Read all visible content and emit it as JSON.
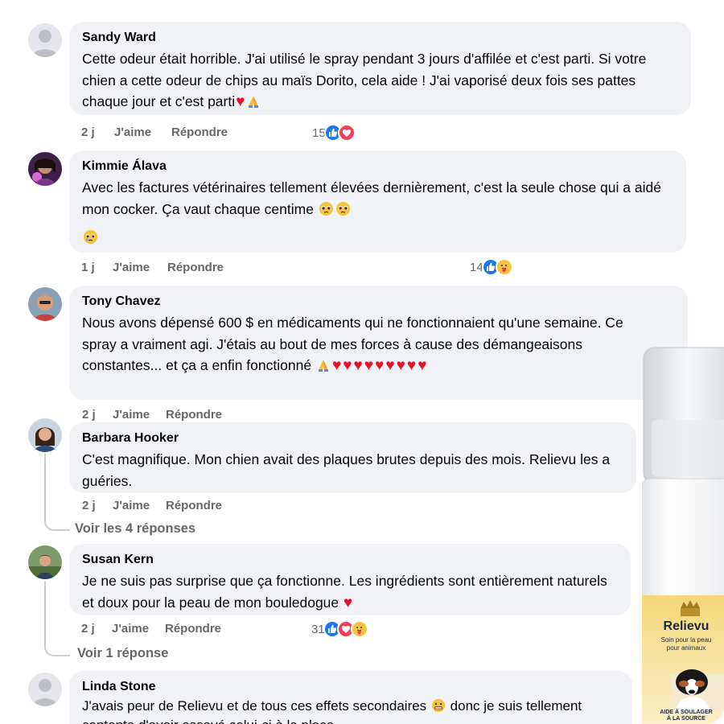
{
  "comments": [
    {
      "author": "Sandy Ward",
      "text": "Cette odeur était horrible. J'ai utilisé le spray pendant 3 jours d'affilée et c'est parti. Si votre chien a cette odeur de chips au maïs Dorito, cela aide ! J'ai vaporisé deux fois ses pattes chaque jour et c'est parti",
      "time": "2 j",
      "like_label": "J'aime",
      "reply_label": "Répondre",
      "reaction_count": "15",
      "reactions": [
        "like",
        "love"
      ]
    },
    {
      "author": "Kimmie Álava",
      "text": "Avec les factures vétérinaires tellement élevées dernièrement, c'est la seule chose qui a aidé mon cocker. Ça vaut chaque centime",
      "time": "1 j",
      "like_label": "J'aime",
      "reply_label": "Répondre",
      "reaction_count": "14",
      "reactions": [
        "like",
        "care"
      ]
    },
    {
      "author": "Tony Chavez",
      "text": "Nous avons dépensé 600 $ en médicaments qui ne fonctionnaient qu'une semaine. Ce spray a vraiment agi. J'étais au bout de mes forces à cause des démangeaisons constantes... et ça a enfin fonctionné",
      "time": "2 j",
      "like_label": "J'aime",
      "reply_label": "Répondre"
    },
    {
      "author": "Barbara Hooker",
      "text": "C'est magnifique. Mon chien avait des plaques brutes depuis des mois. Relievu les a guéries.",
      "time": "2 j",
      "like_label": "J'aime",
      "reply_label": "Répondre",
      "replies_link": "Voir les 4 réponses"
    },
    {
      "author": "Susan Kern",
      "text": "Je ne suis pas surprise que ça fonctionne. Les ingrédients sont entièrement naturels et doux pour la peau de mon bouledogue",
      "time": "2 j",
      "like_label": "J'aime",
      "reply_label": "Répondre",
      "reaction_count": "31",
      "reactions": [
        "like",
        "love",
        "care"
      ],
      "replies_link": "Voir 1 réponse"
    },
    {
      "author": "Linda Stone",
      "text": "J'avais peur de Relievu et de tous ces effets secondaires",
      "text2": "donc je suis tellement contente d'avoir essayé celui-ci à la place."
    }
  ],
  "product": {
    "brand": "Relievu",
    "subtitle_line1": "Soin pour la peau",
    "subtitle_line2": "pour animaux",
    "footer_line1": "AIDE À SOULAGER",
    "footer_line2": "À LA SOURCE"
  },
  "colors": {
    "bubble": "#f0f2f5",
    "meta_text": "#65676b",
    "like_blue": "#1877f2",
    "love_red": "#f33e58",
    "heart": "#e4112b",
    "label_gold": "#f5d77a"
  }
}
